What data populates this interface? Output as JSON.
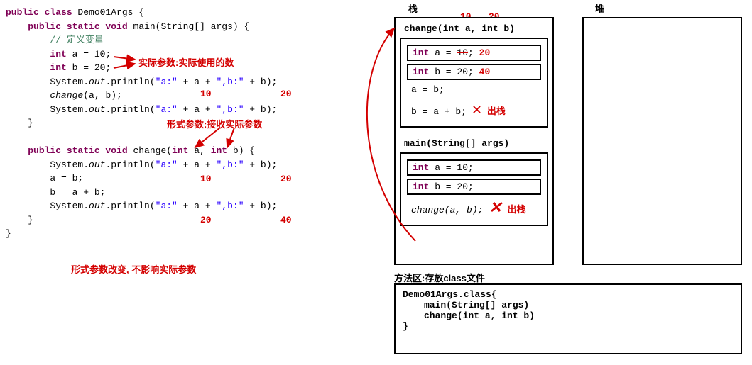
{
  "code": {
    "l1_kw1": "public class ",
    "l1_name": "Demo01Args {",
    "l2_kw": "public static void ",
    "l2_name": "main(String[] args) {",
    "l3_comment": "// 定义变量",
    "l4_kw": "int ",
    "l4_rest": "a = 10;",
    "l5_kw": "int ",
    "l5_rest": "b = 20;",
    "l6a": "System.",
    "l6b": "out",
    "l6c": ".println(",
    "l6d": "\"a:\"",
    "l6e": " + a + ",
    "l6f": "\",b:\"",
    "l6g": " + b);",
    "l7": "change",
    "l7b": "(a, b);",
    "l8a": "System.",
    "l8b": "out",
    "l8c": ".println(",
    "l8d": "\"a:\"",
    "l8e": " + a + ",
    "l8f": "\",b:\"",
    "l8g": " + b);",
    "l9": "}",
    "l11_kw": "public static void ",
    "l11_name": "change(",
    "l11_p1": "int ",
    "l11_p2": "a, ",
    "l11_p3": "int ",
    "l11_p4": "b) {",
    "l12a": "System.",
    "l12b": "out",
    "l12c": ".println(",
    "l12d": "\"a:\"",
    "l12e": " + a + ",
    "l12f": "\",b:\"",
    "l12g": " + b);",
    "l13": "a = b;",
    "l14": "b = a + b;",
    "l15a": "System.",
    "l15b": "out",
    "l15c": ".println(",
    "l15d": "\"a:\"",
    "l15e": " + a + ",
    "l15f": "\",b:\"",
    "l15g": " + b);",
    "l16": "}",
    "l17": "}"
  },
  "annot": {
    "actual_param": "实际参数:实际使用的数",
    "val_10": "10",
    "val_20": "20",
    "val_40": "40",
    "formal_param": "形式参数:接收实际参数",
    "conclusion": "形式参数改变, 不影响实际参数",
    "out_stack": "出栈"
  },
  "diag": {
    "stack_label": "栈",
    "heap_label": "堆",
    "top10": "10",
    "top20": "20",
    "change_sig": "change(int a, int b)",
    "var_a_orig": "int",
    "var_a_rest": " a = ",
    "var_a_old": "10",
    "var_a_semi": "; ",
    "var_a_new": "20",
    "var_b_orig": "int",
    "var_b_rest": " b = ",
    "var_b_old": "20",
    "var_b_semi": "; ",
    "var_b_new": "40",
    "stmt1": "a = b;",
    "stmt2": "b = a + b;",
    "main_sig": "main(String[] args)",
    "main_a": "int",
    "main_a2": " a = 10;",
    "main_b": "int",
    "main_b2": " b = 20;",
    "main_call": "change(a, b);",
    "marea_title": "方法区:存放class文件",
    "marea_cls": "Demo01Args.class{",
    "marea_m1": "main(String[] args)",
    "marea_m2": "change(int a, int b)",
    "marea_end": "}"
  }
}
